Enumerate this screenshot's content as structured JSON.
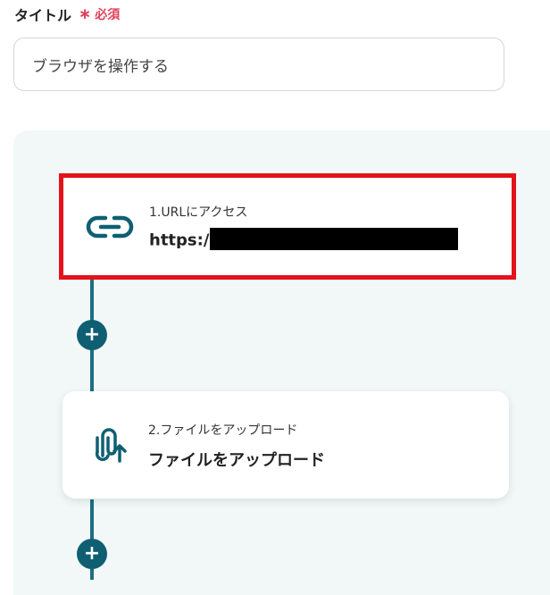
{
  "title_field": {
    "label": "タイトル",
    "required_mark": "∗",
    "required_text": "必須",
    "value": "ブラウザを操作する"
  },
  "steps": [
    {
      "subtitle": "1.URLにアクセス",
      "value": "https:/",
      "icon": "link-icon",
      "highlighted": true
    },
    {
      "subtitle": "2.ファイルをアップロード",
      "value": "ファイルをアップロード",
      "icon": "paperclip-upload-icon",
      "highlighted": false
    }
  ],
  "add_button_label": "+",
  "colors": {
    "accent": "#0f5f73",
    "connector": "#1d6f80",
    "required": "#e0415b",
    "highlight": "#e3121b",
    "flow_bg": "#f2f8f8"
  }
}
